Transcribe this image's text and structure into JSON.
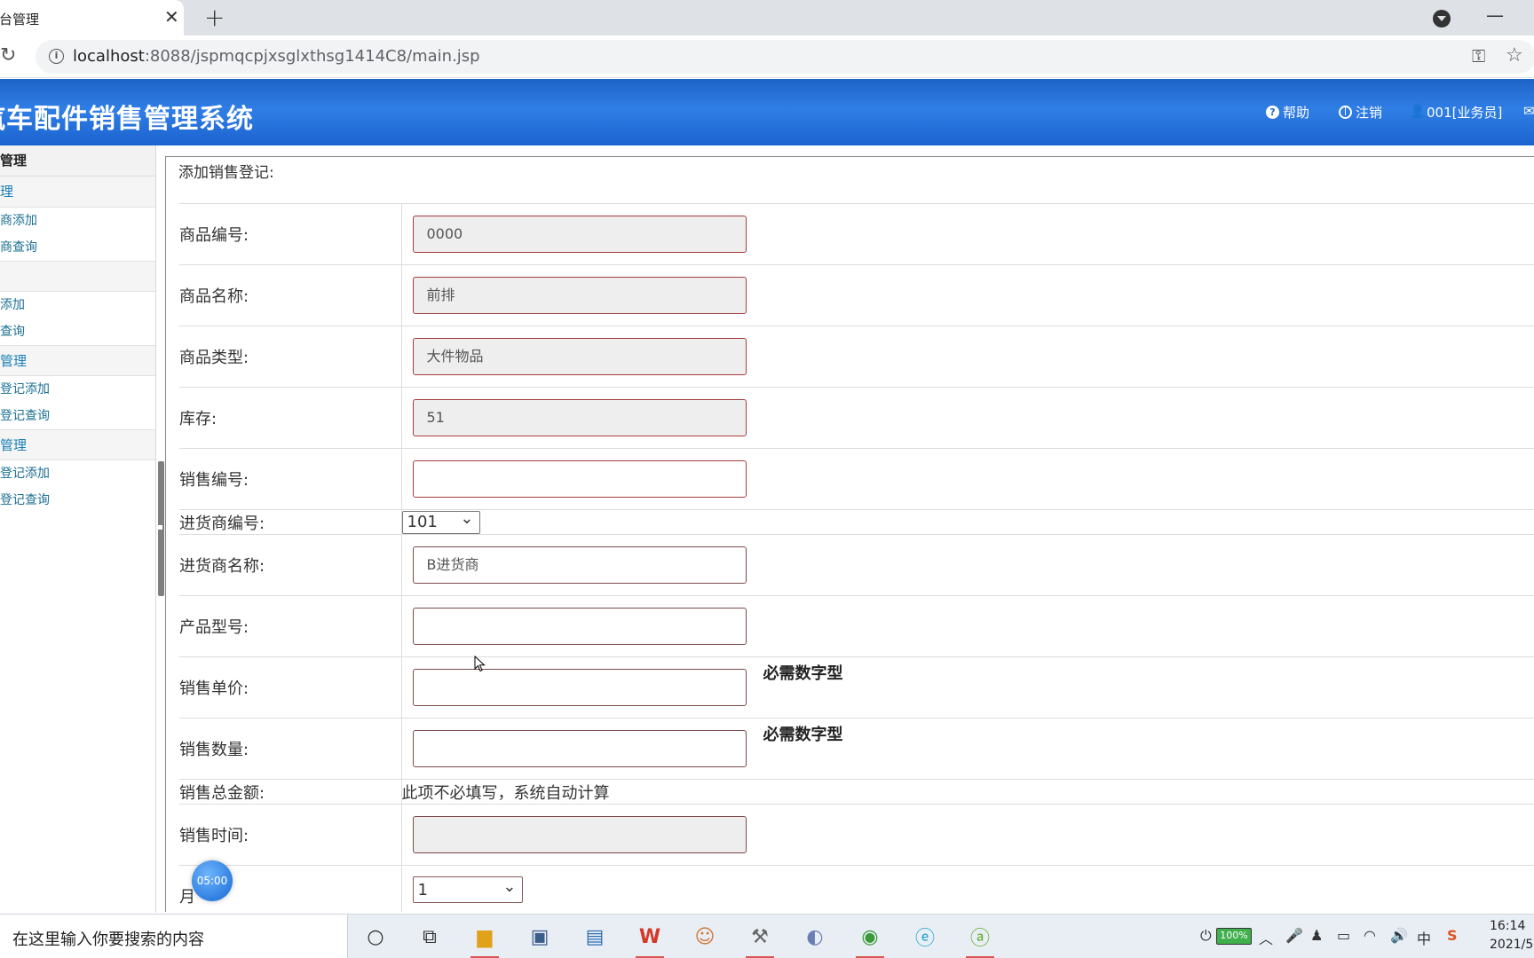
{
  "browser": {
    "tab_title": "后台管理",
    "url_host": "localhost",
    "url_rest": ":8088/jspmqcpjxsglxthsg1414C8/main.jsp"
  },
  "header": {
    "title": "汽车配件销售管理系统",
    "help": "帮助",
    "logout": "注销",
    "user": "001[业务员]"
  },
  "sidebar": {
    "head": "管理",
    "groups": [
      {
        "label": "理",
        "items": [
          "商添加",
          "商查询"
        ]
      },
      {
        "label": "",
        "items": [
          "添加",
          "查询"
        ]
      },
      {
        "label": "管理",
        "items": [
          "登记添加",
          "登记查询"
        ]
      },
      {
        "label": "管理",
        "items": [
          "登记添加",
          "登记查询"
        ]
      }
    ]
  },
  "form": {
    "caption": "添加销售登记:",
    "fields": {
      "product_no": {
        "label": "商品编号:",
        "value": "0000"
      },
      "product_name": {
        "label": "商品名称:",
        "value": "前排"
      },
      "product_type": {
        "label": "商品类型:",
        "value": "大件物品"
      },
      "stock": {
        "label": "库存:",
        "value": "51"
      },
      "sale_no": {
        "label": "销售编号:",
        "value": ""
      },
      "supplier_no": {
        "label": "进货商编号:",
        "selected": "101"
      },
      "supplier_name": {
        "label": "进货商名称:",
        "value": "B进货商"
      },
      "model": {
        "label": "产品型号:",
        "value": ""
      },
      "unit_price": {
        "label": "销售单价:",
        "value": "",
        "hint": "必需数字型"
      },
      "quantity": {
        "label": "销售数量:",
        "value": "",
        "hint": "必需数字型"
      },
      "total": {
        "label": "销售总金额:",
        "note": "此项不必填写，系统自动计算"
      },
      "sale_time": {
        "label": "销售时间:",
        "value": ""
      },
      "month": {
        "label": "月",
        "selected": "1"
      }
    }
  },
  "overlay": {
    "timer": "05:00"
  },
  "taskbar": {
    "search_placeholder": "在这里输入你要搜索的内容",
    "battery": "100%",
    "ime": "中",
    "time": "16:14",
    "date": "2021/5"
  }
}
